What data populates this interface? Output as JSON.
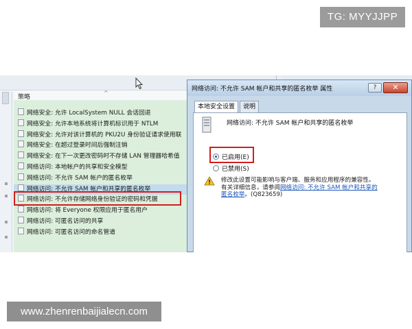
{
  "watermarks": {
    "tg": "TG: MYYJJPP",
    "site": "www.zhenrenbaijialecn.com"
  },
  "policy_list": {
    "column_header": "策略",
    "rows": [
      "网络安全: 允许 LocalSystem NULL 会话回退",
      "网络安全: 允许本地系统将计算机标识用于 NTLM",
      "网络安全: 允许对该计算机的 PKU2U 身份验证请求使用联",
      "网络安全: 在超过登录时间后强制注销",
      "网络安全: 在下一次更改密码时不存储 LAN 管理器哈希值",
      "网络访问: 本地帐户的共享和安全模型",
      "网络访问: 不允许 SAM 帐户的匿名枚举",
      "网络访问: 不允许 SAM 帐户和共享的匿名枚举",
      "网络访问: 不允许存储网络身份验证的密码和凭据",
      "网络访问: 将 Everyone 权限应用于匿名用户",
      "网络访问: 可匿名访问的共享",
      "网络访问: 可匿名访问的命名管道"
    ],
    "selected_index": 7
  },
  "dialog": {
    "title": "网络访问: 不允许 SAM 帐户和共享的匿名枚举 属性",
    "help_label": "?",
    "close_label": "✕",
    "tabs": [
      "本地安全设置",
      "说明"
    ],
    "active_tab": 0,
    "policy_name": "网络访问: 不允许 SAM 帐户和共享的匿名枚举",
    "options": [
      {
        "label": "已启用(E)",
        "checked": true
      },
      {
        "label": "已禁用(S)",
        "checked": false
      }
    ],
    "warning_line1": "修改此设置可能影响与客户端、服务和应用程序的兼容性。",
    "warning_line2_prefix": "有关详细信息，请参阅",
    "warning_link": "网络访问: 不允许 SAM 帐户和共享的",
    "warning_link2": "匿名枚举",
    "warning_suffix": "。(Q823659)"
  },
  "colors": {
    "highlight_box": "#d11d1d",
    "list_background": "#dcefdc",
    "link": "#1a55b8"
  }
}
